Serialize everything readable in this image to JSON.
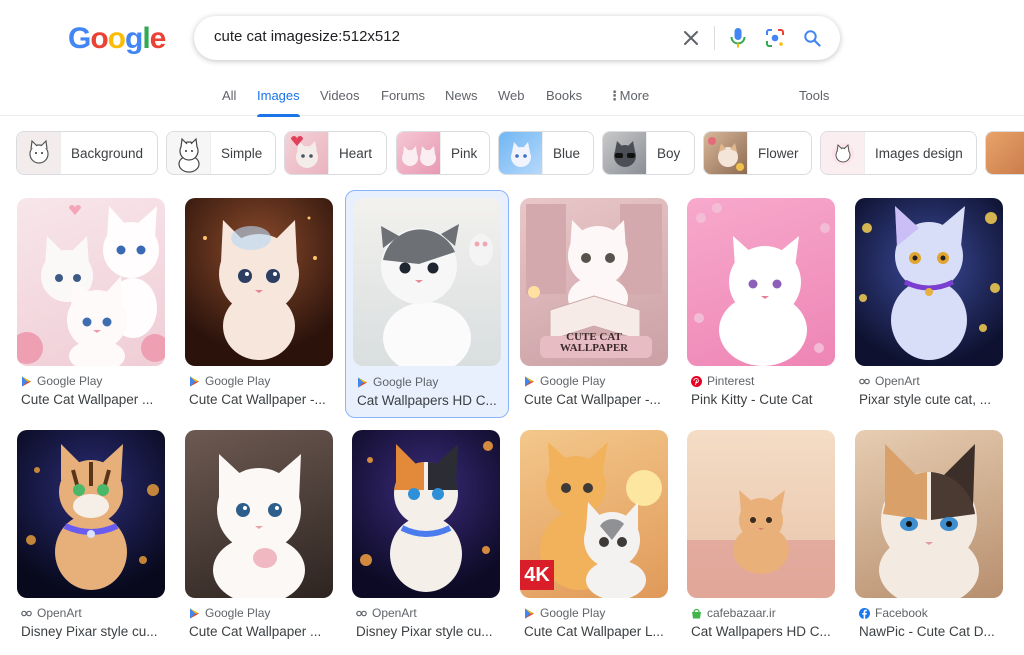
{
  "logo": {
    "letters": [
      "G",
      "o",
      "o",
      "g",
      "l",
      "e"
    ],
    "colors": [
      "#4285f4",
      "#ea4335",
      "#fbbc05",
      "#4285f4",
      "#34a853",
      "#ea4335"
    ]
  },
  "search": {
    "query": "cute cat imagesize:512x512"
  },
  "tabs": [
    {
      "label": "All"
    },
    {
      "label": "Images"
    },
    {
      "label": "Videos"
    },
    {
      "label": "Forums"
    },
    {
      "label": "News"
    },
    {
      "label": "Web"
    },
    {
      "label": "Books"
    },
    {
      "label": "More"
    },
    {
      "label": "Tools"
    }
  ],
  "chips": [
    {
      "label": "Background"
    },
    {
      "label": "Simple"
    },
    {
      "label": "Heart"
    },
    {
      "label": "Pink"
    },
    {
      "label": "Blue"
    },
    {
      "label": "Boy"
    },
    {
      "label": "Flower"
    },
    {
      "label": "Images design"
    }
  ],
  "results": [
    {
      "source": "Google Play",
      "title": "Cute Cat Wallpaper ...",
      "icon": "play-icon"
    },
    {
      "source": "Google Play",
      "title": "Cute Cat Wallpaper -...",
      "icon": "play-icon"
    },
    {
      "source": "Google Play",
      "title": "Cat Wallpapers HD C...",
      "icon": "play-icon"
    },
    {
      "source": "Google Play",
      "title": "Cute Cat Wallpaper -...",
      "icon": "play-icon"
    },
    {
      "source": "Pinterest",
      "title": "Pink Kitty - Cute Cat",
      "icon": "pinterest-icon"
    },
    {
      "source": "OpenArt",
      "title": "Pixar style cute cat, ...",
      "icon": "openart-icon"
    },
    {
      "source": "OpenArt",
      "title": "Disney Pixar style cu...",
      "icon": "openart-icon"
    },
    {
      "source": "Google Play",
      "title": "Cute Cat Wallpaper ...",
      "icon": "play-icon"
    },
    {
      "source": "OpenArt",
      "title": "Disney Pixar style cu...",
      "icon": "openart-icon"
    },
    {
      "source": "Google Play",
      "title": "Cute Cat Wallpaper L...",
      "icon": "play-icon"
    },
    {
      "source": "cafebazaar.ir",
      "title": "Cat Wallpapers HD C...",
      "icon": "cafebazaar-icon"
    },
    {
      "source": "Facebook",
      "title": "NawPic - Cute Cat D...",
      "icon": "facebook-icon"
    }
  ],
  "image_texts": {
    "wallpaper_overlay": "CUTE CAT\nWALLPAPER",
    "badge_4k": "4K"
  },
  "colors": {
    "accent": "#1a73e8",
    "selected_bg": "#e8f0fe"
  }
}
